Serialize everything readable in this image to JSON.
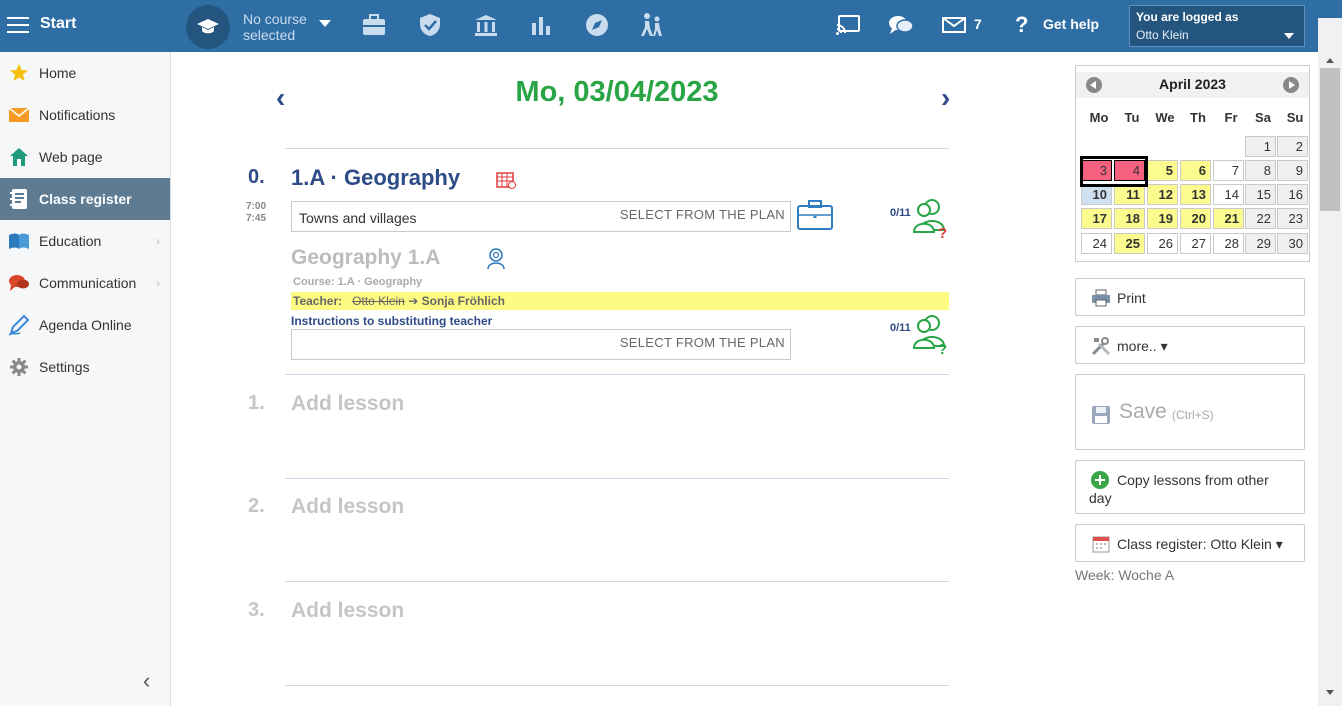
{
  "topbar": {
    "start_label": "Start",
    "course_label_1": "No course",
    "course_label_2": "selected",
    "mail_count": "7",
    "help_q": "?",
    "help_label": "Get help",
    "logged_as_label": "You are logged as",
    "user_name": "Otto Klein"
  },
  "sidebar": {
    "items": [
      {
        "label": "Home",
        "icon": "star-icon"
      },
      {
        "label": "Notifications",
        "icon": "envelope-icon"
      },
      {
        "label": "Web page",
        "icon": "house-icon"
      },
      {
        "label": "Class register",
        "icon": "notebook-icon"
      },
      {
        "label": "Education",
        "icon": "book-icon"
      },
      {
        "label": "Communication",
        "icon": "chat-icon"
      },
      {
        "label": "Agenda Online",
        "icon": "pen-icon"
      },
      {
        "label": "Settings",
        "icon": "gear-icon"
      }
    ],
    "active_index": 3,
    "chevron": "›",
    "collapse": "‹"
  },
  "main": {
    "prev": "‹",
    "next": "›",
    "date_title": "Mo, 03/04/2023",
    "lesson0": {
      "num": "0.",
      "title": "1.A · Geography",
      "time_start": "7:00",
      "time_end": "7:45",
      "topic_value": "Towns and villages",
      "plan_label": "SELECT FROM THE PLAN",
      "attendance": "0/11",
      "sub_title": "Geography  1.A",
      "course_line": "Course:  1.A · Geography",
      "teacher_label": "Teacher:",
      "teacher_old": "Otto Klein",
      "teacher_arrow": "➔",
      "teacher_new": "Sonja Fröhlich",
      "instructions_label": "Instructions to substituting teacher",
      "instr_plan_label": "SELECT FROM THE PLAN",
      "attendance2": "0/11"
    },
    "add_lessons": [
      {
        "num": "1.",
        "label": "Add lesson"
      },
      {
        "num": "2.",
        "label": "Add lesson"
      },
      {
        "num": "3.",
        "label": "Add lesson"
      }
    ]
  },
  "calendar": {
    "month": "April 2023",
    "dows": [
      "Mo",
      "Tu",
      "We",
      "Th",
      "Fr",
      "Sa",
      "Su"
    ],
    "rows": [
      [
        {
          "d": "",
          "t": "none"
        },
        {
          "d": "",
          "t": "none"
        },
        {
          "d": "",
          "t": "none"
        },
        {
          "d": "",
          "t": "none"
        },
        {
          "d": "",
          "t": "none"
        },
        {
          "d": "1",
          "t": "other"
        },
        {
          "d": "2",
          "t": "other"
        }
      ],
      [
        {
          "d": "3",
          "t": "sel"
        },
        {
          "d": "4",
          "t": "sel"
        },
        {
          "d": "5",
          "t": "yel"
        },
        {
          "d": "6",
          "t": "yel"
        },
        {
          "d": "7",
          "t": "norm"
        },
        {
          "d": "8",
          "t": "other"
        },
        {
          "d": "9",
          "t": "other"
        }
      ],
      [
        {
          "d": "10",
          "t": "cur"
        },
        {
          "d": "11",
          "t": "yel"
        },
        {
          "d": "12",
          "t": "yel"
        },
        {
          "d": "13",
          "t": "yel"
        },
        {
          "d": "14",
          "t": "norm"
        },
        {
          "d": "15",
          "t": "other"
        },
        {
          "d": "16",
          "t": "other"
        }
      ],
      [
        {
          "d": "17",
          "t": "yel"
        },
        {
          "d": "18",
          "t": "yel"
        },
        {
          "d": "19",
          "t": "yel"
        },
        {
          "d": "20",
          "t": "yel"
        },
        {
          "d": "21",
          "t": "yel"
        },
        {
          "d": "22",
          "t": "other"
        },
        {
          "d": "23",
          "t": "other"
        }
      ],
      [
        {
          "d": "24",
          "t": "norm"
        },
        {
          "d": "25",
          "t": "yel"
        },
        {
          "d": "26",
          "t": "norm"
        },
        {
          "d": "27",
          "t": "norm"
        },
        {
          "d": "28",
          "t": "norm"
        },
        {
          "d": "29",
          "t": "other"
        },
        {
          "d": "30",
          "t": "other"
        }
      ]
    ]
  },
  "right": {
    "print_label": "Print",
    "more_label": "more.. ▾",
    "save_label": "Save",
    "save_shortcut": "(Ctrl+S)",
    "copy_label_1": "Copy lessons from other",
    "copy_label_2": "day",
    "register_label": "Class register: Otto Klein ▾",
    "week_label": "Week: Woche A"
  }
}
